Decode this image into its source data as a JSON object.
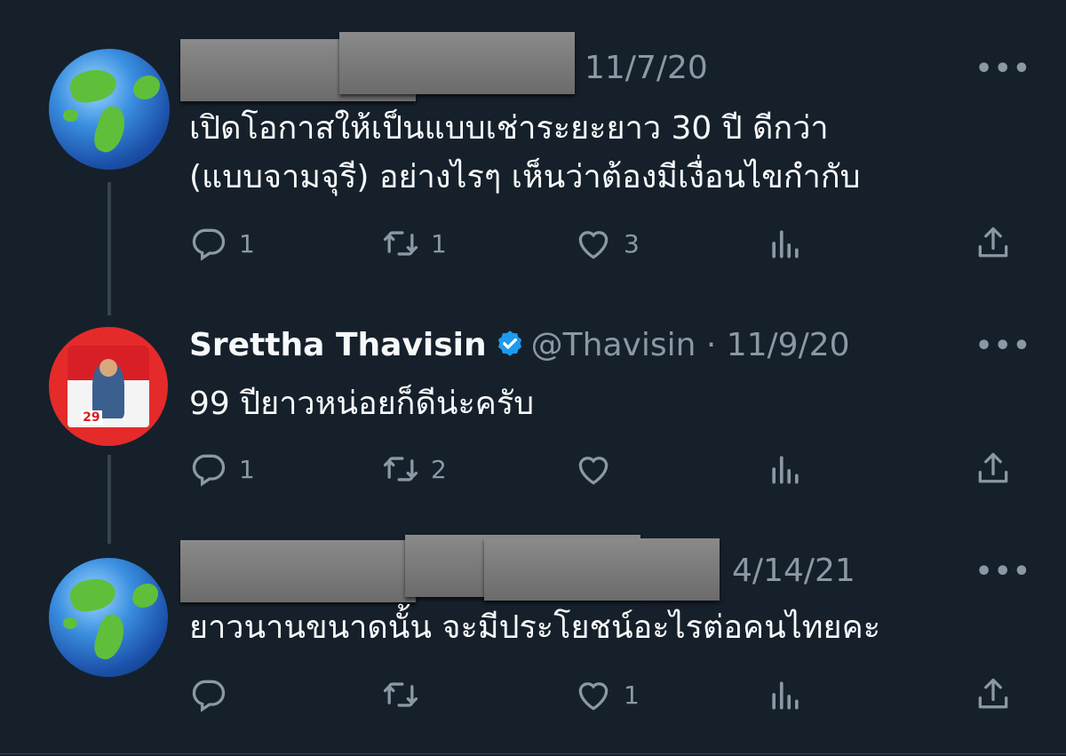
{
  "tweets": [
    {
      "avatar": "globe-emoji",
      "name": "",
      "handle": "",
      "date": "11/7/20",
      "text_lines": [
        "เปิดโอกาสให้เป็นแบบเช่าระยะยาว 30 ปี ดีกว่า",
        "(แบบจามจุรี) อย่างไรๆ เห็นว่าต้องมีเงื่อนไขกำกับ"
      ],
      "replies": "1",
      "retweets": "1",
      "likes": "3"
    },
    {
      "avatar": "campaign-poster",
      "avatar_number": "29",
      "name": "Srettha Thavisin",
      "handle": "@Thavisin",
      "date": "· 11/9/20",
      "text_lines": [
        "99 ปียาวหน่อยก็ดีน่ะครับ"
      ],
      "replies": "1",
      "retweets": "2",
      "likes": ""
    },
    {
      "avatar": "globe-emoji",
      "name": "",
      "handle": "",
      "date": "4/14/21",
      "text_lines": [
        "ยาวนานขนาดนั้น จะมีประโยชน์อะไรต่อคนไทยคะ"
      ],
      "replies": "",
      "retweets": "",
      "likes": "1"
    }
  ],
  "more_label": "•••",
  "colors": {
    "background": "#15202b",
    "text": "#f7f9f9",
    "muted": "#8b98a5",
    "verified": "#1d9bf0",
    "divider": "#38444d"
  },
  "icons": [
    "reply-icon",
    "retweet-icon",
    "like-icon",
    "views-icon",
    "share-icon",
    "verified-badge-icon",
    "more-icon"
  ]
}
